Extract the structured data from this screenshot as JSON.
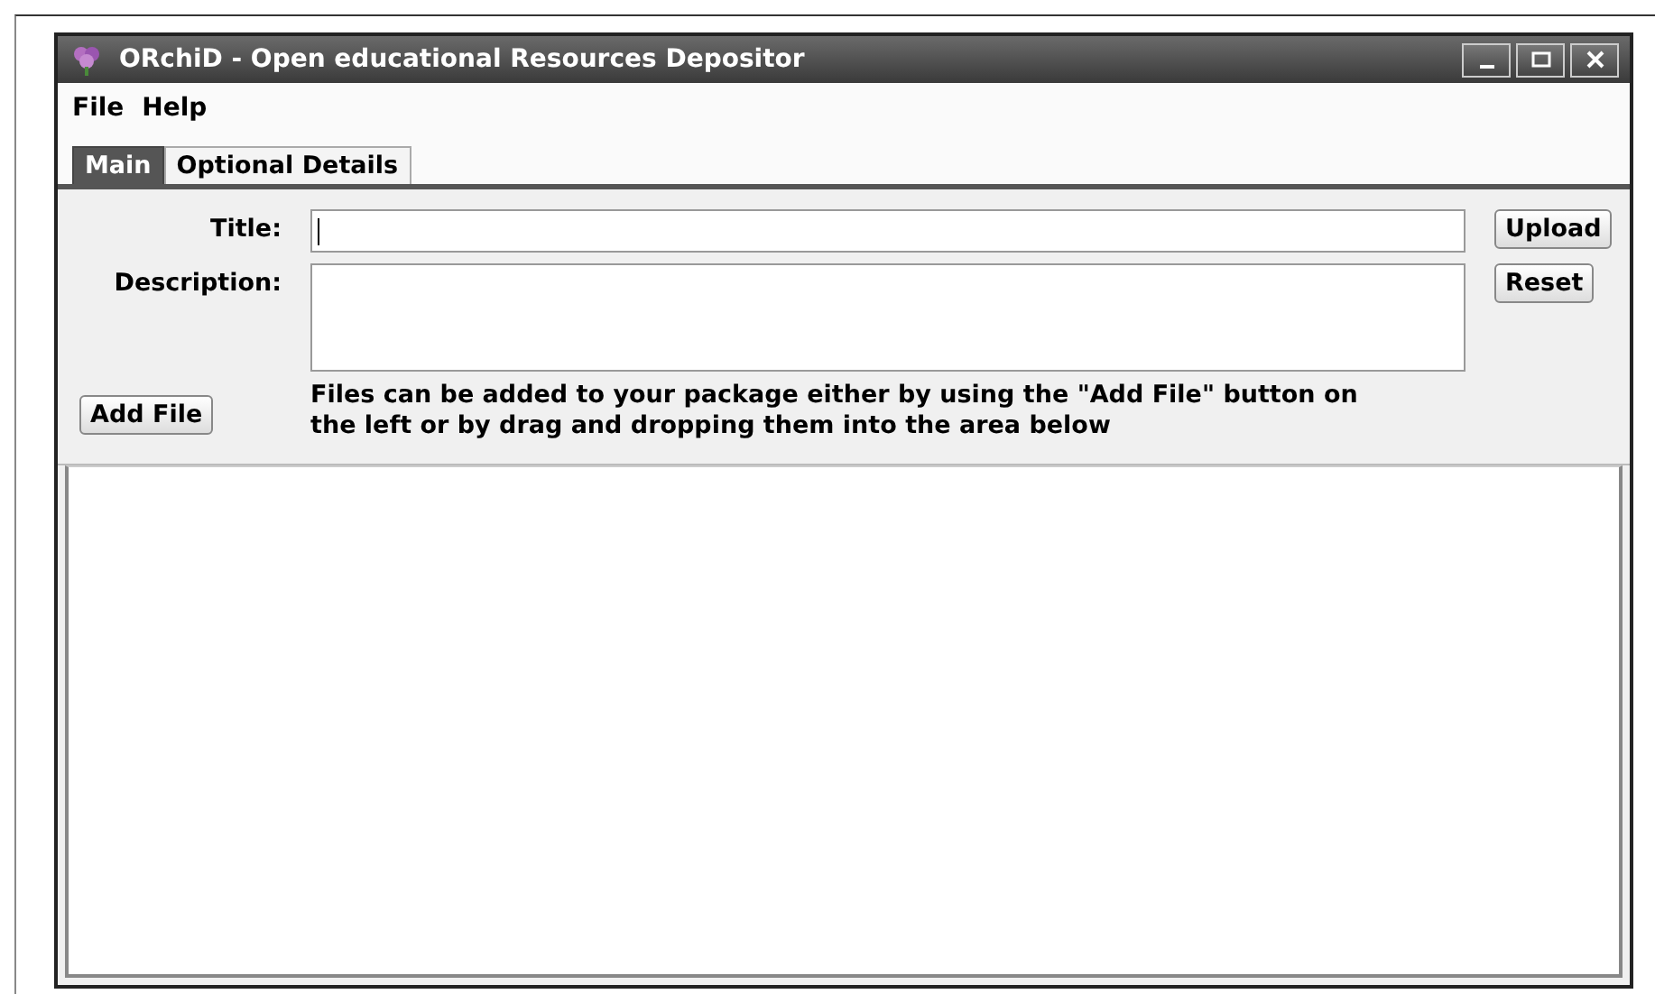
{
  "window": {
    "title": "ORchiD - Open educational Resources Depositor"
  },
  "menu": [
    "File",
    "Help"
  ],
  "tabs": [
    {
      "label": "Main",
      "selected": true
    },
    {
      "label": "Optional Details",
      "selected": false
    }
  ],
  "form": {
    "title_label": "Title:",
    "description_label": "Description:",
    "upload": "Upload",
    "reset": "Reset",
    "add_file": "Add File",
    "hint": "Files can be added to your package either by using the \"Add File\" button on the left or by drag and dropping them into the area below"
  }
}
